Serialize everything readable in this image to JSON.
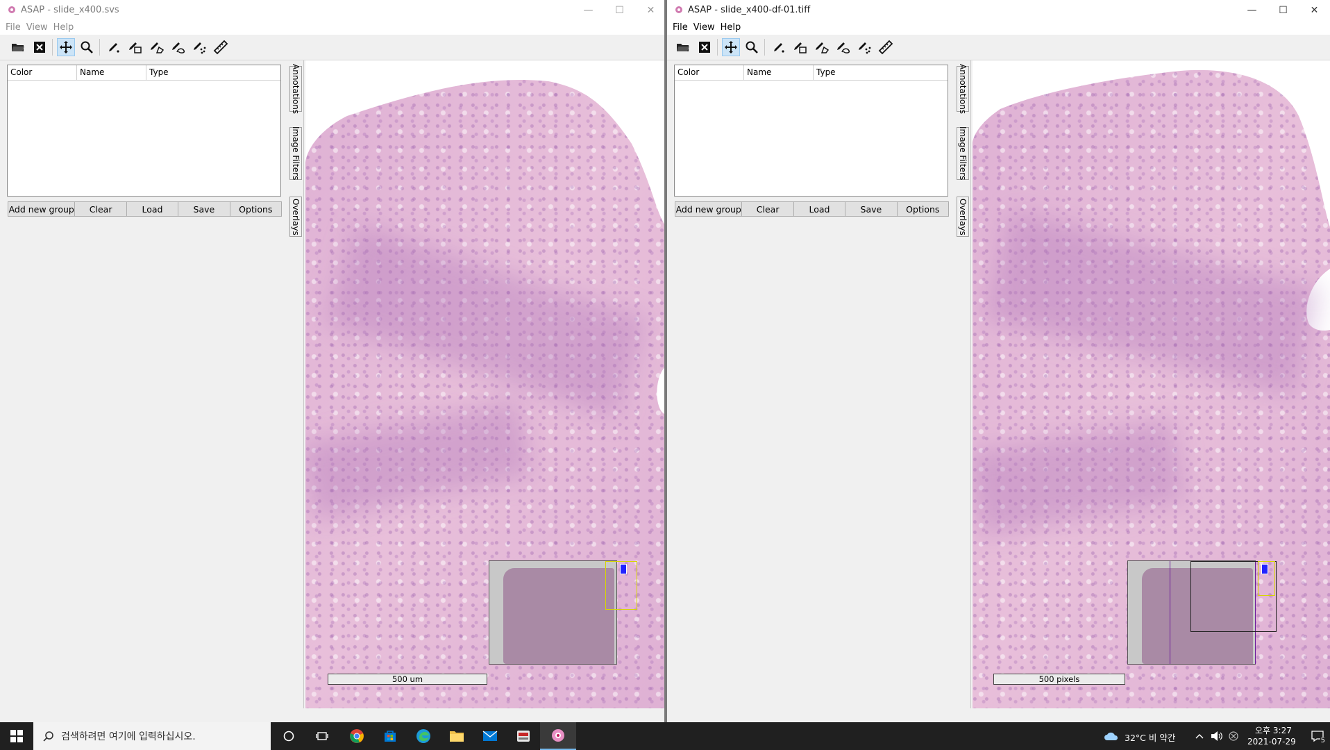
{
  "windows": {
    "left": {
      "title": "ASAP - slide_x400.svs",
      "menu": [
        "File",
        "View",
        "Help"
      ],
      "annotation_columns": [
        "Color",
        "Name",
        "Type"
      ],
      "buttons": [
        "Add new group",
        "Clear",
        "Load",
        "Save",
        "Options"
      ],
      "side_tabs": [
        "Annotations",
        "Image Filters",
        "Overlays"
      ],
      "scalebar_label": "500 um"
    },
    "right": {
      "title": "ASAP - slide_x400-df-01.tiff",
      "menu": [
        "File",
        "View",
        "Help"
      ],
      "annotation_columns": [
        "Color",
        "Name",
        "Type"
      ],
      "buttons": [
        "Add new group",
        "Clear",
        "Load",
        "Save",
        "Options"
      ],
      "side_tabs": [
        "Annotations",
        "Image Filters",
        "Overlays"
      ],
      "scalebar_label": "500 pixels"
    }
  },
  "toolbar_icons": [
    "open-folder-icon",
    "close-file-icon",
    "pan-icon",
    "zoom-icon",
    "dot-annotation-icon",
    "rectangle-annotation-icon",
    "polygon-annotation-icon",
    "spline-annotation-icon",
    "point-set-annotation-icon",
    "ruler-icon"
  ],
  "taskbar": {
    "search_placeholder": "검색하려면 여기에 입력하십시오.",
    "weather": "32°C 비 약간",
    "time": "오후 3:27",
    "date": "2021-07-29",
    "notification_count": "5"
  },
  "colors": {
    "tissue_pink": "#e6bdd8",
    "overview_frame_yellow": "#d7d700",
    "overview_marker_blue": "#2323ff",
    "taskbar_bg": "#202020"
  }
}
